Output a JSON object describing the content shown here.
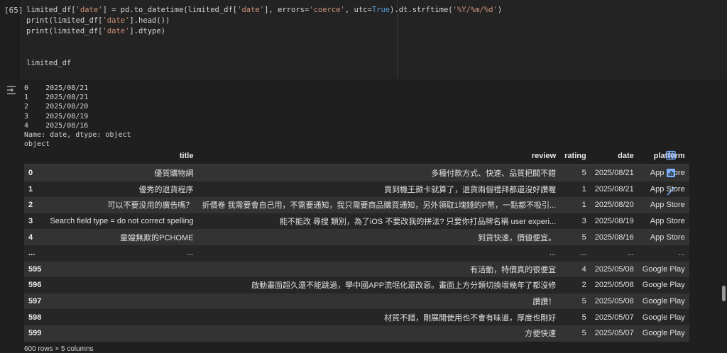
{
  "cell": {
    "execution_count": "[65]",
    "code": {
      "line1_a": "limited_df[",
      "line1_str1": "'date'",
      "line1_b": "] = pd.to_datetime(limited_df[",
      "line1_str2": "'date'",
      "line1_c": "], errors=",
      "line1_str3": "'coerce'",
      "line1_d": ", utc=",
      "line1_kw": "True",
      "line1_e": ").dt.strftime(",
      "line1_str4": "'%Y/%m/%d'",
      "line1_f": ")",
      "line2_a": "print(limited_df[",
      "line2_str": "'date'",
      "line2_b": "].head())",
      "line3_a": "print(limited_df[",
      "line3_str": "'date'",
      "line3_b": "].dtype)",
      "line4": "limited_df"
    }
  },
  "output": {
    "icon": "output-toggle-icon",
    "stdout": [
      "0    2025/08/21",
      "1    2025/08/21",
      "2    2025/08/20",
      "3    2025/08/19",
      "4    2025/08/16",
      "Name: date, dtype: object",
      "object"
    ],
    "table": {
      "headers": [
        "",
        "title",
        "review",
        "rating",
        "date",
        "platform"
      ],
      "rows": [
        [
          "0",
          "優質購物網",
          "多種付款方式、快速、品質把關不錯",
          "5",
          "2025/08/21",
          "App Store"
        ],
        [
          "1",
          "優秀的退貨程序",
          "買到機王颞卡就算了，退貨兩個禮拜都還沒好讚喔",
          "1",
          "2025/08/21",
          "App Store"
        ],
        [
          "2",
          "可以不要没用的廣告嗎？",
          "折價卷 我需要會自己用，不需要通知，我只需要商品購買通知，另外領取1塊錢的P幣，一點都不吸引...",
          "1",
          "2025/08/20",
          "App Store"
        ],
        [
          "3",
          "Search field type = do not correct spelling",
          "能不能改 尋搜 類別，為了iOS 不要改我的拼法? 只要你打品牌名稱 user experi...",
          "3",
          "2025/08/19",
          "App Store"
        ],
        [
          "4",
          "童嫂無欺的PCHOME",
          "到貨快速，價値便宜。",
          "5",
          "2025/08/16",
          "App Store"
        ],
        [
          "...",
          "...",
          "...",
          "...",
          "...",
          "..."
        ],
        [
          "595",
          "",
          "有活動，特價真的很便宜",
          "4",
          "2025/05/08",
          "Google Play"
        ],
        [
          "596",
          "",
          "啟動畫面超久還不能跳過，學中國APP流氓化還改惡。畫面上方分類切換壞幾年了都沒修",
          "2",
          "2025/05/08",
          "Google Play"
        ],
        [
          "597",
          "",
          "讚讚！",
          "5",
          "2025/05/08",
          "Google Play"
        ],
        [
          "598",
          "",
          "材質不錯，剛展開使用也不會有味道，厚度也剛好",
          "5",
          "2025/05/07",
          "Google Play"
        ],
        [
          "599",
          "",
          "方便快速",
          "5",
          "2025/05/07",
          "Google Play"
        ]
      ]
    },
    "shape": "600 rows × 5 columns",
    "side_buttons": [
      {
        "name": "convert-to-table-icon",
        "label": "table"
      },
      {
        "name": "suggest-charts-icon",
        "label": "chart"
      },
      {
        "name": "generate-code-icon",
        "label": "magic"
      }
    ]
  },
  "colors": {
    "background": "#1f1f1f",
    "string": "#ce9178",
    "keyword": "#569cd6",
    "accent": "#7fb3ff"
  }
}
